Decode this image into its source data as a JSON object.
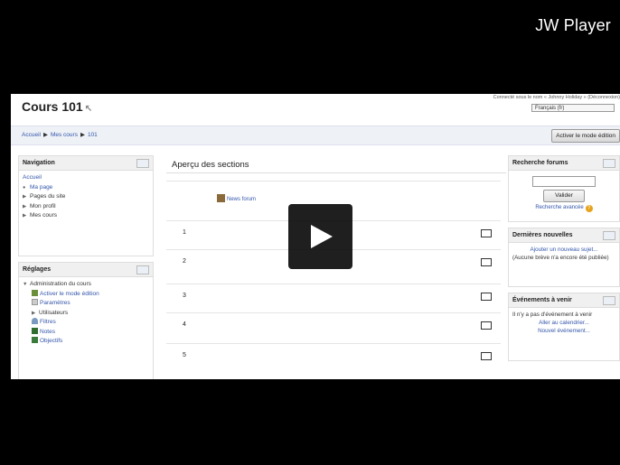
{
  "player": {
    "brand": "JW Player",
    "play_icon": "play-icon"
  },
  "moodle": {
    "course_title": "Cours 101",
    "login_info": "Connecté sous le nom « Johnny Holiday » (Déconnexion)",
    "language": "Français (fr)",
    "breadcrumb": {
      "home": "Accueil",
      "my_courses": "Mes cours",
      "course": "101"
    },
    "edit_button": "Activer le mode édition",
    "navigation": {
      "title": "Navigation",
      "home": "Accueil",
      "items": [
        "Ma page",
        "Pages du site",
        "Mon profil",
        "Mes cours"
      ]
    },
    "settings": {
      "title": "Réglages",
      "admin_title": "Administration du cours",
      "items": [
        "Activer le mode édition",
        "Paramètres",
        "Utilisateurs",
        "Filtres",
        "Notes",
        "Objectifs"
      ]
    },
    "sections": {
      "title": "Aperçu des sections",
      "news_forum": "News forum",
      "numbers": [
        "1",
        "2",
        "3",
        "4",
        "5"
      ]
    },
    "search_forums": {
      "title": "Recherche forums",
      "button": "Valider",
      "advanced": "Recherche avancée"
    },
    "latest_news": {
      "title": "Dernières nouvelles",
      "add_topic": "Ajouter un nouveau sujet...",
      "no_news": "(Aucune brève n'a encore été publiée)"
    },
    "upcoming_events": {
      "title": "Événements à venir",
      "no_events": "Il n'y a pas d'événement à venir",
      "calendar": "Aller au calendrier...",
      "new_event": "Nouvel événement..."
    }
  }
}
